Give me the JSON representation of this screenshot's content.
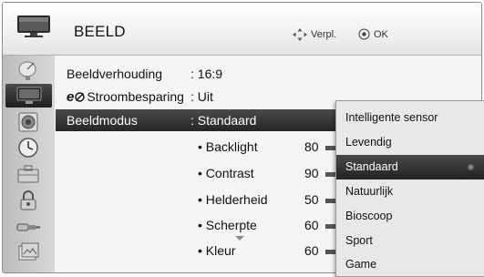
{
  "header": {
    "title": "BEELD",
    "move_hint": "Verpl.",
    "ok_hint": "OK"
  },
  "sidebar": {
    "items": [
      {
        "icon": "satellite-dish-icon"
      },
      {
        "icon": "tv-picture-icon",
        "active": true
      },
      {
        "icon": "speaker-icon"
      },
      {
        "icon": "clock-icon"
      },
      {
        "icon": "toolbox-icon"
      },
      {
        "icon": "lock-icon"
      },
      {
        "icon": "input-plug-icon"
      },
      {
        "icon": "media-photo-icon"
      }
    ]
  },
  "settings": {
    "aspect": {
      "label": "Beeldverhouding",
      "value": ": 16:9"
    },
    "eco": {
      "logo": "e",
      "label": "Stroombesparing",
      "value": ": Uit"
    },
    "mode": {
      "label": "Beeldmodus",
      "value": ": Standaard"
    },
    "sub": [
      {
        "label": "• Backlight",
        "value": "80"
      },
      {
        "label": "• Contrast",
        "value": "90"
      },
      {
        "label": "• Helderheid",
        "value": "50"
      },
      {
        "label": "• Scherpte",
        "value": "60"
      },
      {
        "label": "• Kleur",
        "value": "60"
      }
    ]
  },
  "dropdown": {
    "options": [
      "Intelligente sensor",
      "Levendig",
      "Standaard",
      "Natuurlijk",
      "Bioscoop",
      "Sport",
      "Game"
    ],
    "selected": "Standaard"
  }
}
